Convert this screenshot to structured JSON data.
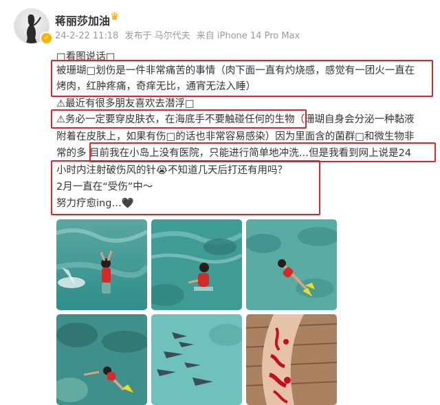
{
  "user": {
    "name": "蒋丽莎加油",
    "timestamp": "24-2-22 11:18",
    "location": "发布于 马尔代夫",
    "device": "来自 iPhone 14 Pro Max"
  },
  "post": {
    "lines": [
      "□看图说话□",
      "被珊瑚□划伤是一件非常痛苦的事情（肉下面一直有灼烧感，感觉有一团火一直在",
      "烤肉，红肿疼痛，奇痒无比，通宵无法入睡）",
      "⚠最近有很多朋友喜欢去潜浮□",
      "⚠务必一定要穿皮肤衣，在海底手不要触碰任何的生物（珊瑚自身会分泌一种黏液",
      "附着在皮肤上，如果有伤□的话也非常容易感染）因为里面含的菌群□和微生物非",
      "常的多  目前我在小岛上没有医院，只能进行简单地冲洗…但是我看到网上说是24",
      "小时内注射破伤风的针😭不知道几天后打还有用吗？",
      "2月一直在“受伤”中～",
      "努力疗愈ing…🖤"
    ]
  },
  "photos": [
    {
      "name": "photo-woman-splashing",
      "icon": "swimmer-photo"
    },
    {
      "name": "photo-woman-wading",
      "icon": "swimmer-photo"
    },
    {
      "name": "photo-snorkeling",
      "icon": "snorkel-photo"
    },
    {
      "name": "photo-swimming-reef",
      "icon": "snorkel-photo"
    },
    {
      "name": "photo-sharks",
      "icon": "shark-photo"
    },
    {
      "name": "photo-leg-injury",
      "icon": "injury-photo"
    }
  ],
  "colors": {
    "highlight_box": "#d8262b",
    "verified_badge": "#f6b400",
    "meta_text": "#9a9a9a"
  }
}
